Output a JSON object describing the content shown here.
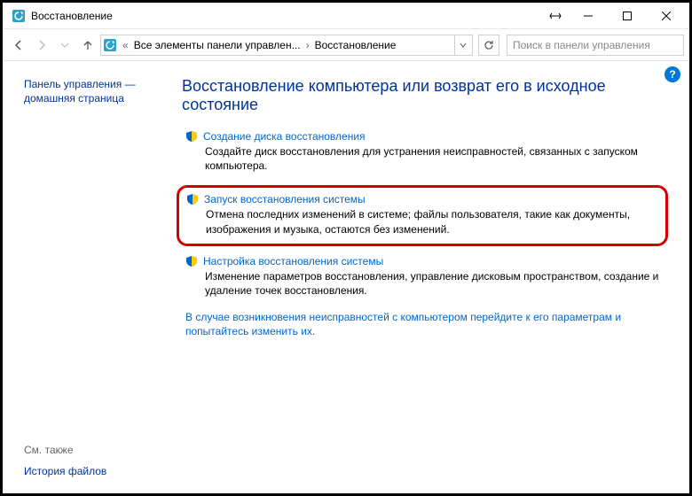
{
  "window": {
    "title": "Восстановление"
  },
  "addressbar": {
    "seg1": "Все элементы панели управлен...",
    "seg2": "Восстановление"
  },
  "search": {
    "placeholder": "Поиск в панели управления"
  },
  "sidebar": {
    "home": "Панель управления — домашняя страница",
    "seealso": "См. также",
    "link1": "История файлов"
  },
  "main": {
    "heading": "Восстановление компьютера или возврат его в исходное состояние",
    "items": [
      {
        "link": "Создание диска восстановления",
        "desc": "Создайте диск восстановления для устранения неисправностей, связанных с запуском компьютера."
      },
      {
        "link": "Запуск восстановления системы",
        "desc": "Отмена последних изменений в системе; файлы пользователя, такие как документы, изображения и музыка, остаются без изменений."
      },
      {
        "link": "Настройка восстановления системы",
        "desc": "Изменение параметров восстановления, управление дисковым пространством, создание и удаление точек восстановления."
      }
    ],
    "footer_link": "В случае возникновения неисправностей с компьютером перейдите к его параметрам и попытайтесь изменить их."
  }
}
